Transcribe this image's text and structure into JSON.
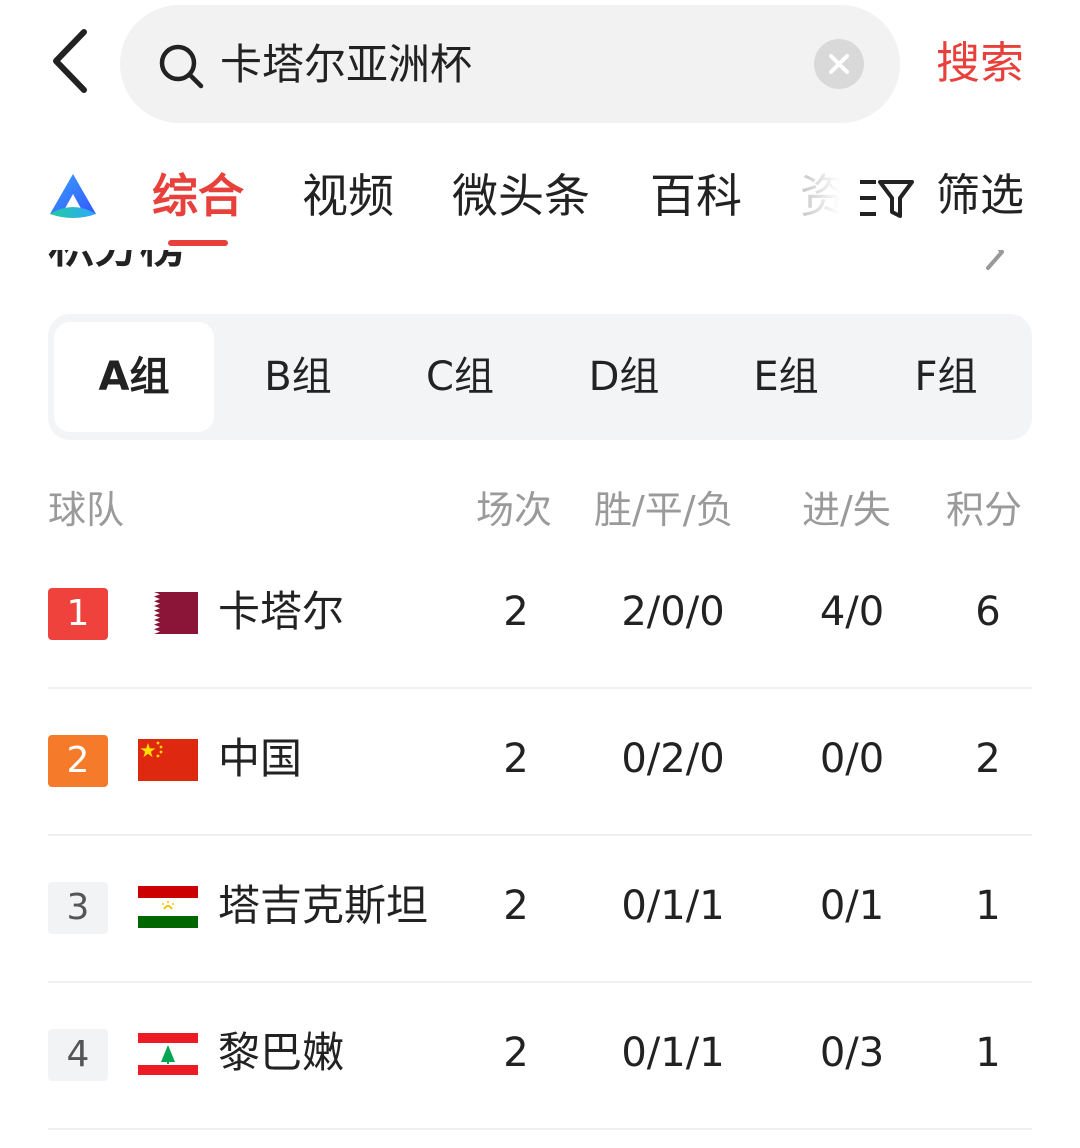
{
  "search": {
    "query": "卡塔尔亚洲杯",
    "submit_label": "搜索"
  },
  "tabs": [
    {
      "label": "综合",
      "active": true
    },
    {
      "label": "视频",
      "active": false
    },
    {
      "label": "微头条",
      "active": false
    },
    {
      "label": "百科",
      "active": false
    },
    {
      "label": "资",
      "active": false
    }
  ],
  "filter_label": "筛选",
  "section": {
    "title": "积分榜"
  },
  "groups": [
    {
      "label": "A组",
      "active": true
    },
    {
      "label": "B组",
      "active": false
    },
    {
      "label": "C组",
      "active": false
    },
    {
      "label": "D组",
      "active": false
    },
    {
      "label": "E组",
      "active": false
    },
    {
      "label": "F组",
      "active": false
    }
  ],
  "table": {
    "headers": {
      "team": "球队",
      "played": "场次",
      "wdl": "胜/平/负",
      "goals": "进/失",
      "points": "积分"
    },
    "rows": [
      {
        "rank": "1",
        "team": "卡塔尔",
        "flag": "qatar-flag-icon",
        "played": "2",
        "wdl": "2/0/0",
        "goals": "4/0",
        "points": "6"
      },
      {
        "rank": "2",
        "team": "中国",
        "flag": "china-flag-icon",
        "played": "2",
        "wdl": "0/2/0",
        "goals": "0/0",
        "points": "2"
      },
      {
        "rank": "3",
        "team": "塔吉克斯坦",
        "flag": "tajikistan-flag-icon",
        "played": "2",
        "wdl": "0/1/1",
        "goals": "0/1",
        "points": "1"
      },
      {
        "rank": "4",
        "team": "黎巴嫩",
        "flag": "lebanon-flag-icon",
        "played": "2",
        "wdl": "0/1/1",
        "goals": "0/3",
        "points": "1"
      }
    ]
  },
  "colors": {
    "accent": "#e8403a",
    "rank1": "#f0423d",
    "rank2": "#f57b2b",
    "rank_other_bg": "#f2f3f5",
    "rank_other_text": "#555555"
  }
}
